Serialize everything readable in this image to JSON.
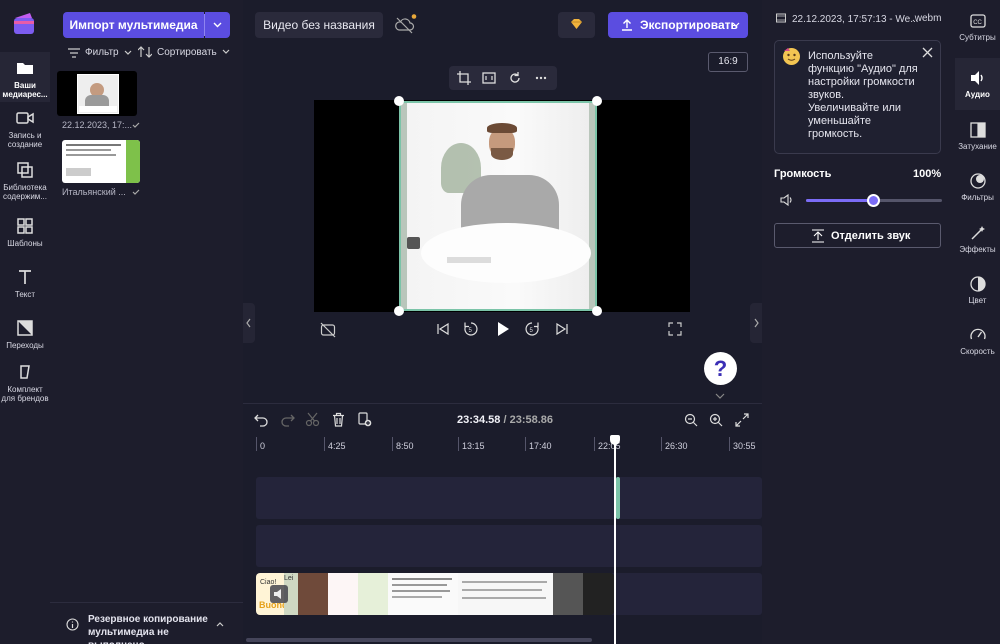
{
  "left_rail": {
    "items": [
      {
        "label": "Ваши медиарес..."
      },
      {
        "label": "Запись и создание"
      },
      {
        "label": "Библиотека содержим..."
      },
      {
        "label": "Шаблоны"
      },
      {
        "label": "Текст"
      },
      {
        "label": "Переходы"
      },
      {
        "label": "Комплект для брендов"
      }
    ]
  },
  "media": {
    "import_label": "Импорт мультимедиа",
    "filter_label": "Фильтр",
    "sort_label": "Сортировать",
    "items": [
      {
        "label": "22.12.2023, 17:..."
      },
      {
        "label": "Итальянский ..."
      }
    ],
    "backup_notice": "Резервное копирование мультимедиа не выполнено"
  },
  "header": {
    "title": "Видео без названия",
    "export_label": "Экспортировать"
  },
  "preview": {
    "aspect_ratio": "16:9"
  },
  "timeline": {
    "current_time": "23:34.58",
    "separator": " / ",
    "total_time": "23:58.86",
    "ruler": [
      "0",
      "4:25",
      "8:50",
      "13:15",
      "17:40",
      "22:05",
      "26:30",
      "30:55"
    ],
    "clip_texts": {
      "a": "Lei",
      "b": "Ciao!",
      "c": "Buondì"
    }
  },
  "properties": {
    "file_date": "22.12.2023, 17:57:13 - We...",
    "file_ext": ".webm",
    "tip": "Используйте функцию \"Аудио\" для настройки громкости звуков. Увеличивайте или уменьшайте громкость.",
    "volume_label": "Громкость",
    "volume_value": "100%",
    "split_audio_label": "Отделить звук"
  },
  "right_rail": {
    "items": [
      {
        "label": "Субтитры"
      },
      {
        "label": "Аудио"
      },
      {
        "label": "Затухание"
      },
      {
        "label": "Фильтры"
      },
      {
        "label": "Эффекты"
      },
      {
        "label": "Цвет"
      },
      {
        "label": "Скорость"
      }
    ]
  },
  "help_label": "?",
  "colors": {
    "accent": "#5b4de0",
    "background": "#1b1c2b",
    "panel": "#1d1d2c",
    "selection": "#7bc4a8"
  }
}
